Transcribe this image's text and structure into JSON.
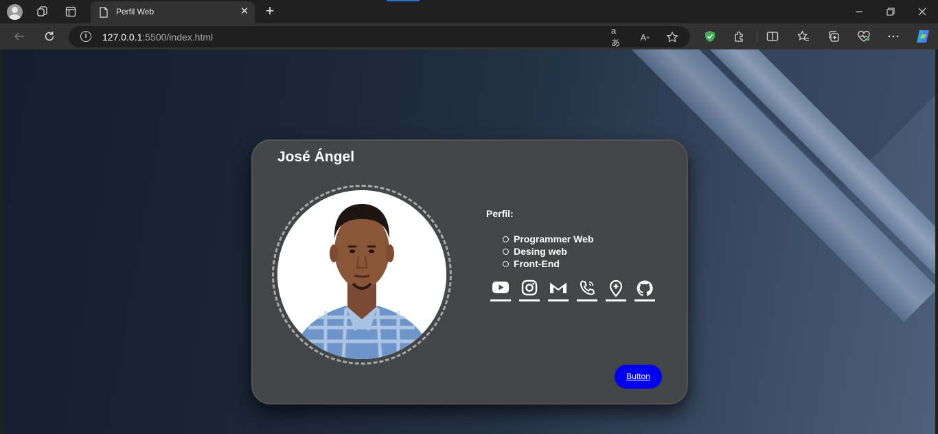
{
  "browser": {
    "tab": {
      "title": "Perfil Web"
    },
    "address": {
      "host": "127.0.0.1",
      "path": ":5500/index.html"
    },
    "icons": [
      "profile-avatar",
      "workspaces-icon",
      "tab-actions-icon",
      "page-icon",
      "close-icon",
      "plus-icon",
      "minimize-icon",
      "restore-icon",
      "close-window-icon",
      "back-arrow-icon",
      "refresh-icon",
      "info-icon",
      "translate-icon",
      "read-aloud-icon",
      "favorite-star-icon",
      "shield-extension-icon",
      "extensions-icon",
      "split-screen-icon",
      "favorites-icon",
      "collections-icon",
      "health-icon",
      "more-icon",
      "copilot-icon"
    ],
    "accent": "#2b6fd6"
  },
  "card": {
    "name": "José Ángel",
    "profile_heading": "Perfil:",
    "skills": [
      "Programmer Web",
      "Desing web",
      "Front-End"
    ],
    "social_icons": [
      "youtube-icon",
      "instagram-icon",
      "gmail-icon",
      "phone-icon",
      "location-icon",
      "github-icon"
    ],
    "button_label": "Button",
    "button_color": "#0000ee",
    "card_color": "#424646"
  }
}
